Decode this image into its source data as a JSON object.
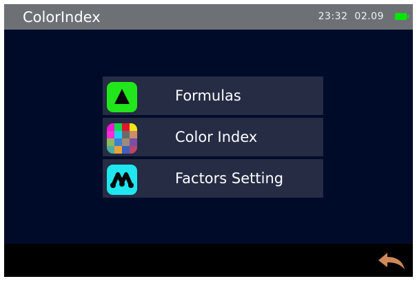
{
  "header": {
    "title": "ColorIndex",
    "time": "23:32",
    "date": "02.09",
    "battery_icon": "battery-icon"
  },
  "menu": {
    "items": [
      {
        "label": "Formulas",
        "icon": "triangle-icon",
        "icon_color": "#21e61c"
      },
      {
        "label": "Color Index",
        "icon": "color-palette-icon"
      },
      {
        "label": "Factors Setting",
        "icon": "factors-icon",
        "icon_color": "#1fe6ef"
      }
    ]
  },
  "footer": {
    "back_icon": "back-arrow-icon",
    "back_color": "#d0885a"
  },
  "theme": {
    "background": "#000b2a",
    "titlebar": "#6d7176",
    "item_bg": "#252c44"
  }
}
